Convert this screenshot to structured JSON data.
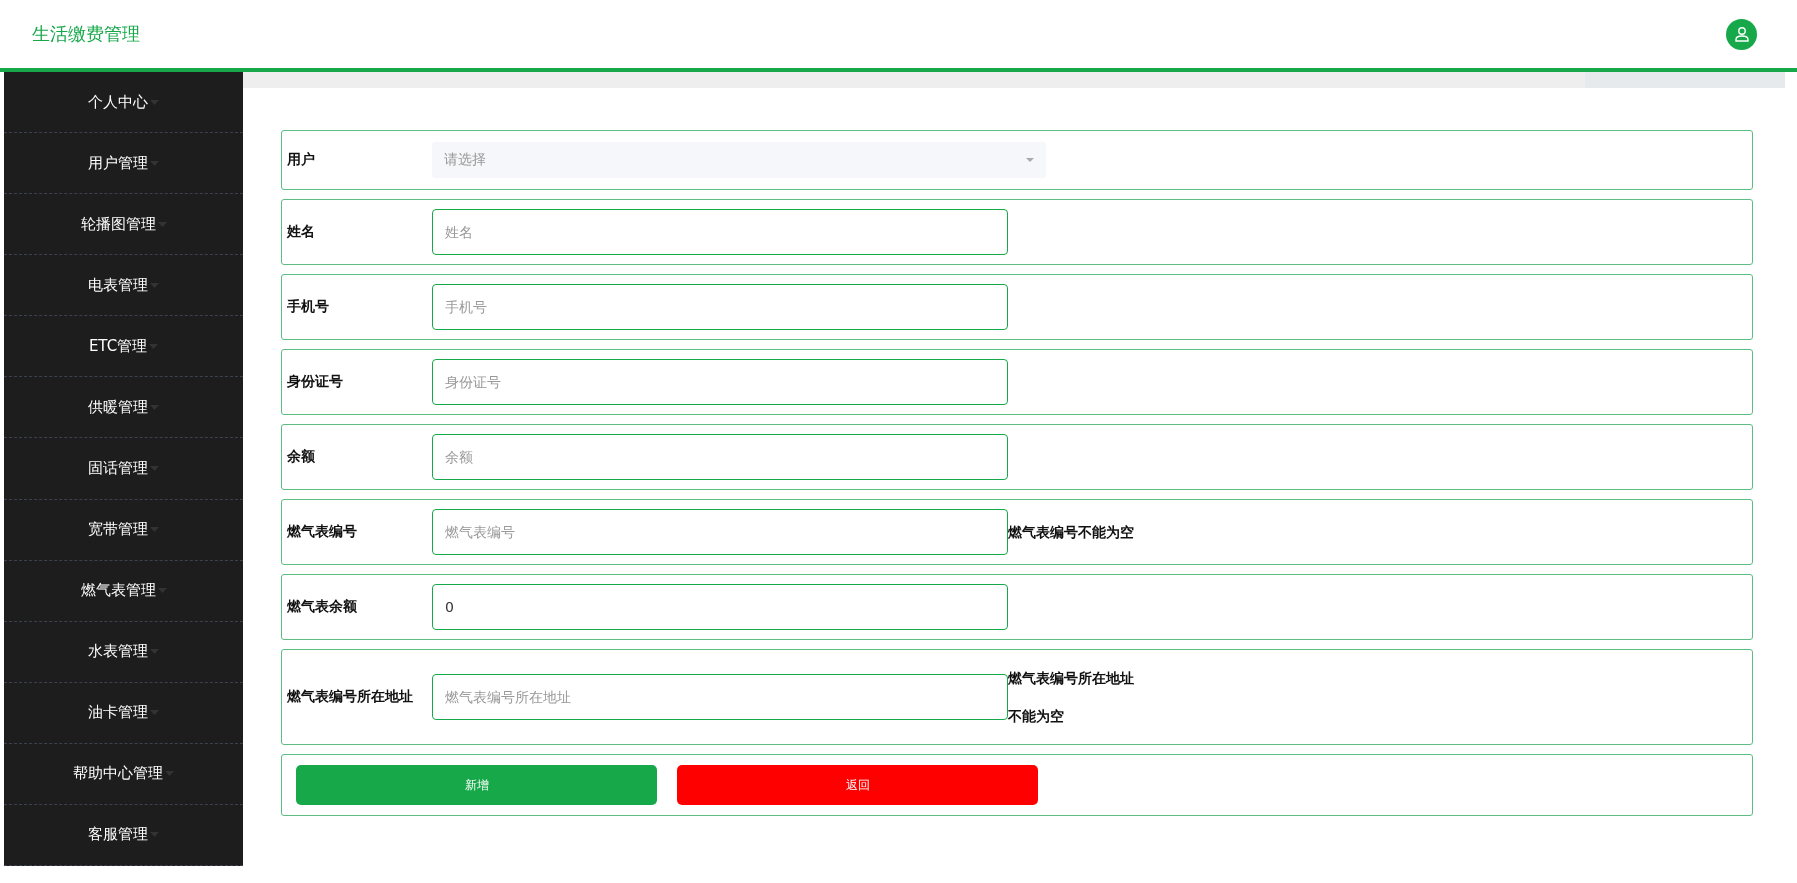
{
  "header": {
    "title": "生活缴费管理"
  },
  "sidebar": {
    "items": [
      {
        "label": "个人中心"
      },
      {
        "label": "用户管理"
      },
      {
        "label": "轮播图管理"
      },
      {
        "label": "电表管理"
      },
      {
        "label": "ETC管理"
      },
      {
        "label": "供暖管理"
      },
      {
        "label": "固话管理"
      },
      {
        "label": "宽带管理"
      },
      {
        "label": "燃气表管理"
      },
      {
        "label": "水表管理"
      },
      {
        "label": "油卡管理"
      },
      {
        "label": "帮助中心管理"
      },
      {
        "label": "客服管理"
      }
    ]
  },
  "form": {
    "fields": [
      {
        "kind": "select",
        "label": "用户",
        "placeholder": "请选择"
      },
      {
        "kind": "input",
        "label": "姓名",
        "placeholder": "姓名"
      },
      {
        "kind": "input",
        "label": "手机号",
        "placeholder": "手机号"
      },
      {
        "kind": "input",
        "label": "身份证号",
        "placeholder": "身份证号"
      },
      {
        "kind": "input",
        "label": "余额",
        "placeholder": "余额"
      },
      {
        "kind": "input",
        "label": "燃气表编号",
        "placeholder": "燃气表编号",
        "error": "燃气表编号不能为空"
      },
      {
        "kind": "input",
        "label": "燃气表余额",
        "value": "0"
      },
      {
        "kind": "input",
        "label": "燃气表编号所在地址",
        "placeholder": "燃气表编号所在地址",
        "error": "燃气表编号所在地址不能为空"
      }
    ],
    "buttons": [
      {
        "kind": "primary",
        "label": "新增"
      },
      {
        "kind": "danger",
        "label": "返回"
      }
    ]
  }
}
